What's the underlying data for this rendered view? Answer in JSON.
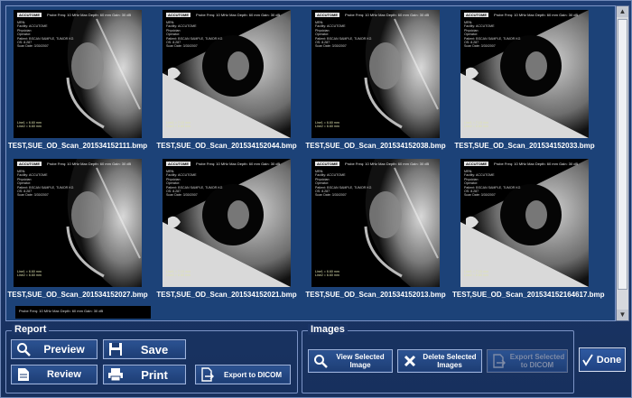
{
  "thumbnails": [
    {
      "caption": "TEST,SUE_OD_Scan_201534152111.bmp",
      "style": "a",
      "hdr": "Probe Freq: 10 MHz   Max Depth: 60 mm   Gain: 30 dB",
      "meas": "Line1 = 6.60 mm\nLine2 = 6.60 mm"
    },
    {
      "caption": "TEST,SUE_OD_Scan_201534152044.bmp",
      "style": "b",
      "hdr": "Probe Freq: 10 MHz   Max Depth: 60 mm   Gain: 30 dB",
      "meas": "Line1 = 7.10 mm\nLine2 = 6.80 mm"
    },
    {
      "caption": "TEST,SUE_OD_Scan_201534152038.bmp",
      "style": "a",
      "hdr": "Probe Freq: 10 MHz   Max Depth: 60 mm   Gain: 30 dB",
      "meas": "Line1 = 6.60 mm\nLine2 = 6.60 mm"
    },
    {
      "caption": "TEST,SUE_OD_Scan_201534152033.bmp",
      "style": "b",
      "hdr": "Probe Freq: 10 MHz   Max Depth: 60 mm   Gain: 30 dB",
      "meas": "Line1 = 7.10 mm\nLine2 = 6.80 mm"
    },
    {
      "caption": "TEST,SUE_OD_Scan_201534152027.bmp",
      "style": "a",
      "hdr": "Probe Freq: 10 MHz   Max Depth: 60 mm   Gain: 30 dB",
      "meas": "Line1 = 6.60 mm\nLine2 = 6.60 mm"
    },
    {
      "caption": "TEST,SUE_OD_Scan_201534152021.bmp",
      "style": "b",
      "hdr": "Probe Freq: 10 MHz   Max Depth: 60 mm   Gain: 30 dB",
      "meas": "Line1 = 7.10 mm\nLine2 = 6.80 mm"
    },
    {
      "caption": "TEST,SUE_OD_Scan_201534152013.bmp",
      "style": "a",
      "hdr": "Probe Freq: 10 MHz   Max Depth: 60 mm   Gain: 30 dB",
      "meas": "Line1 = 6.60 mm\nLine2 = 6.60 mm"
    },
    {
      "caption": "TEST,SUE_OD_Scan_201534152164617.bmp",
      "style": "b",
      "hdr": "Probe Freq: 10 MHz   Max Depth: 60 mm   Gain: 30 dB",
      "meas": "Line1 = 7.10 mm\nLine2 = 6.80 mm"
    }
  ],
  "thumbnail_logo": "ACCUTOME",
  "thumbnail_meta": "MRN:\nFacility: ACCUTOME\nPhysician:\nOperator:\nPatient: BSCAN SAMPLE, TUMOR KG\nOS: 8.287\nScan Date: 3/30/2007",
  "partial_thumb_hdr": "Probe Freq: 10 MHz   Max Depth: 60 mm   Gain: 30 dB",
  "report": {
    "legend": "Report",
    "preview_label": "Preview",
    "review_label": "Review",
    "save_label": "Save",
    "print_label": "Print",
    "export_dicom_label": "Export to DICOM"
  },
  "images": {
    "legend": "Images",
    "view_selected_label": "View Selected Image",
    "delete_selected_label": "Delete Selected Images",
    "export_selected_label": "Export Selected to DICOM"
  },
  "done_label": "Done",
  "icons": {
    "preview": "magnifier-icon",
    "review": "document-icon",
    "save": "floppy-disk-icon",
    "print": "printer-icon",
    "export": "export-document-icon",
    "view": "magnifier-icon",
    "delete": "x-icon",
    "done": "checkmark-icon"
  },
  "colors": {
    "background": "#1b3566",
    "gallery": "#1c4278",
    "button": "#2c5393",
    "caption": "#ffffff"
  }
}
